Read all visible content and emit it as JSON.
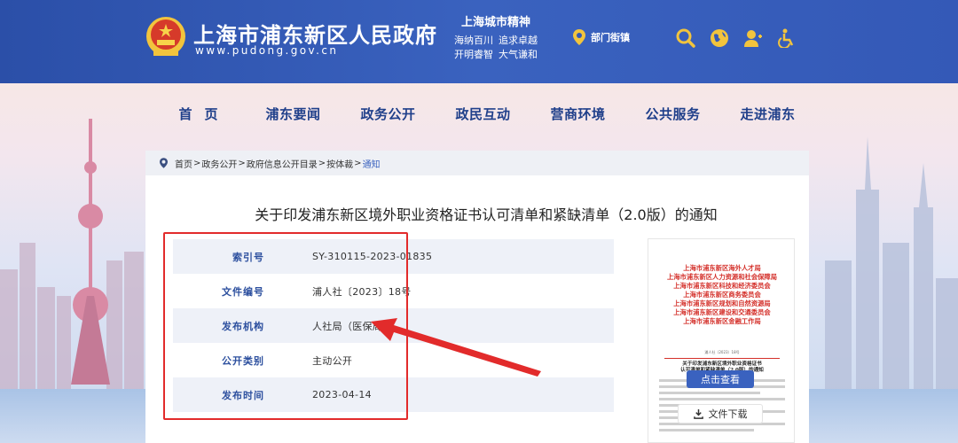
{
  "header": {
    "site_title": "上海市浦东新区人民政府",
    "site_url": "www.pudong.gov.cn",
    "spirit_title": "上海城市精神",
    "spirit_line1": [
      "海纳百川",
      "追求卓越"
    ],
    "spirit_line2": [
      "开明睿智",
      "大气谦和"
    ],
    "dept_link": "部门街镇",
    "icons": [
      "search-icon",
      "globe-icon",
      "user-icon",
      "accessibility-icon"
    ]
  },
  "nav": {
    "items": [
      "首页",
      "浦东要闻",
      "政务公开",
      "政民互动",
      "营商环境",
      "公共服务",
      "走进浦东"
    ]
  },
  "breadcrumb": {
    "items": [
      "首页",
      "政务公开",
      "政府信息公开目录",
      "按体裁"
    ],
    "current": "通知",
    "separator": ">"
  },
  "document": {
    "title": "关于印发浦东新区境外职业资格证书认可清单和紧缺清单（2.0版）的通知",
    "meta": [
      {
        "label": "索引号",
        "value": "SY-310115-2023-01835"
      },
      {
        "label": "文件编号",
        "value": "浦人社〔2023〕18号"
      },
      {
        "label": "发布机构",
        "value": "人社局（医保局）"
      },
      {
        "label": "公开类别",
        "value": "主动公开"
      },
      {
        "label": "发布时间",
        "value": "2023-04-14"
      }
    ]
  },
  "preview": {
    "issuers": [
      "上海市浦东新区海外人才局",
      "上海市浦东新区人力资源和社会保障局",
      "上海市浦东新区科技和经济委员会",
      "上海市浦东新区商务委员会",
      "上海市浦东新区规划和自然资源局",
      "上海市浦东新区建设和交通委员会",
      "上海市浦东新区金融工作局"
    ],
    "doc_number": "浦人社〔2023〕18号",
    "doc_title_line1": "关于印发浦东新区境外职业资格证书",
    "doc_title_line2": "认可清单和紧缺清单（2.0版）的通知",
    "view_label": "点击查看",
    "download_label": "文件下载"
  },
  "colors": {
    "header_blue": "#3459b7",
    "nav_text": "#1f3f8a",
    "highlight_red": "#e22b2b",
    "label_blue": "#2c4f9e",
    "seal_red": "#d4302a"
  }
}
